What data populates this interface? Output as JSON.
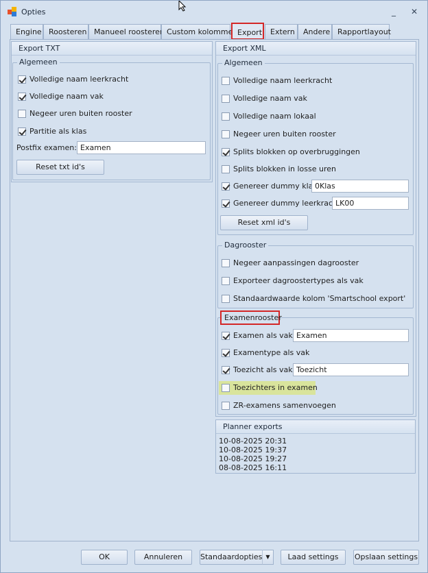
{
  "window": {
    "title": "Opties"
  },
  "tabs": [
    "Engine",
    "Roosteren",
    "Manueel roosteren",
    "Custom kolommen",
    "Export",
    "Extern",
    "Andere",
    "Rapportlayout"
  ],
  "active_tab": "Export",
  "export_txt": {
    "title": "Export TXT",
    "algemeen": {
      "legend": "Algemeen",
      "options": [
        {
          "label": "Volledige naam leerkracht",
          "checked": true
        },
        {
          "label": "Volledige naam vak",
          "checked": true
        },
        {
          "label": "Negeer uren buiten rooster",
          "checked": false
        },
        {
          "label": "Partitie als klas",
          "checked": true
        }
      ],
      "postfix_label": "Postfix examen:",
      "postfix_value": "Examen",
      "reset_button": "Reset txt id's"
    }
  },
  "export_xml": {
    "title": "Export XML",
    "algemeen": {
      "legend": "Algemeen",
      "options": [
        {
          "label": "Volledige naam leerkracht",
          "checked": false
        },
        {
          "label": "Volledige naam vak",
          "checked": false
        },
        {
          "label": "Volledige naam lokaal",
          "checked": false
        },
        {
          "label": "Negeer uren buiten rooster",
          "checked": false
        },
        {
          "label": "Splits blokken op overbruggingen",
          "checked": true
        },
        {
          "label": "Splits blokken in losse uren",
          "checked": false
        },
        {
          "label": "Genereer dummy klas:",
          "checked": true
        },
        {
          "label": "Genereer dummy leerkracht:",
          "checked": true
        }
      ],
      "dummy_klas_value": "0Klas",
      "dummy_leerkracht_value": "LK00",
      "reset_button": "Reset xml id's"
    },
    "dagrooster": {
      "legend": "Dagrooster",
      "options": [
        {
          "label": "Negeer aanpassingen dagrooster",
          "checked": false
        },
        {
          "label": "Exporteer dagroostertypes als vak",
          "checked": false
        },
        {
          "label": "Standaardwaarde kolom 'Smartschool export'",
          "checked": false
        }
      ]
    },
    "examenrooster": {
      "legend": "Examenrooster",
      "options": [
        {
          "label": "Examen als vak:",
          "checked": true
        },
        {
          "label": "Examentype als vak",
          "checked": true
        },
        {
          "label": "Toezicht als vak:",
          "checked": true
        },
        {
          "label": "Toezichters in examen",
          "checked": false
        },
        {
          "label": "ZR-examens samenvoegen",
          "checked": false
        }
      ],
      "examen_value": "Examen",
      "toezicht_value": "Toezicht"
    }
  },
  "planner_exports": {
    "title": "Planner exports",
    "entries": [
      "10-08-2025 20:31",
      "10-08-2025 19:37",
      "10-08-2025 19:27",
      "08-08-2025 16:11"
    ]
  },
  "footer": {
    "ok": "OK",
    "annuleren": "Annuleren",
    "standaardopties": "Standaardopties",
    "laad_settings": "Laad settings",
    "opslaan_settings": "Opslaan settings"
  },
  "colors": {
    "highlight_red": "#d42626",
    "highlight_green": "#d9e49c",
    "window_bg": "#d5e1ef"
  },
  "icons": [
    "app-icon",
    "minimize-icon",
    "close-icon",
    "mouse-cursor-icon",
    "dropdown-arrow-icon"
  ]
}
